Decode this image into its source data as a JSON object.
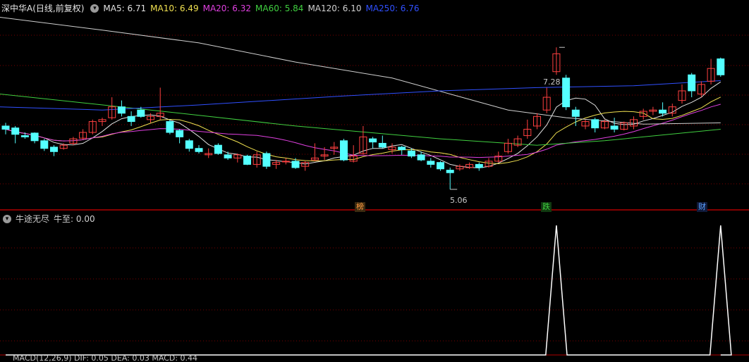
{
  "header": {
    "stock_title": "深中华A(日线,前复权)",
    "ma": [
      {
        "label": "MA5: 6.71",
        "color": "#e0e0e0"
      },
      {
        "label": "MA10: 6.49",
        "color": "#f0e050"
      },
      {
        "label": "MA20: 6.32",
        "color": "#e040e0"
      },
      {
        "label": "MA60: 5.84",
        "color": "#40d040"
      },
      {
        "label": "MA120: 6.10",
        "color": "#d0d0d0"
      },
      {
        "label": "MA250: 6.76",
        "color": "#3050ff"
      }
    ]
  },
  "indicator": {
    "name": "牛途无尽",
    "value": "牛至: 0.00"
  },
  "bottom_header": "MACD(12,26,9)  DIF: 0.05  DEA: 0.03  MACD: 0.44",
  "annotations": {
    "high": "7.28",
    "low": "5.06"
  },
  "event_tags": [
    {
      "text": "榜",
      "color": "#ff9a40"
    },
    {
      "text": "跌",
      "color": "#40d040"
    },
    {
      "text": "财",
      "color": "#5aa0ff"
    }
  ],
  "colors": {
    "up": "#ff4040",
    "down": "#54ffff",
    "grid": "#7a0000",
    "background": "#000000"
  },
  "chart_data": {
    "type": "candlestick",
    "price_range": [
      4.75,
      7.8
    ],
    "candles": [
      [
        6.05,
        6.0,
        6.1,
        5.92
      ],
      [
        6.02,
        5.92,
        6.05,
        5.78
      ],
      [
        5.9,
        5.88,
        5.95,
        5.85
      ],
      [
        5.94,
        5.82,
        5.95,
        5.78
      ],
      [
        5.82,
        5.7,
        5.85,
        5.66
      ],
      [
        5.72,
        5.65,
        5.75,
        5.58
      ],
      [
        5.7,
        5.75,
        5.78,
        5.68
      ],
      [
        5.78,
        5.85,
        5.88,
        5.75
      ],
      [
        5.86,
        5.95,
        6.0,
        5.84
      ],
      [
        5.95,
        6.12,
        6.15,
        5.92
      ],
      [
        6.12,
        6.15,
        6.18,
        6.05
      ],
      [
        6.18,
        6.35,
        6.5,
        6.15
      ],
      [
        6.35,
        6.25,
        6.45,
        6.2
      ],
      [
        6.2,
        6.12,
        6.28,
        6.05
      ],
      [
        6.3,
        6.2,
        6.35,
        6.18
      ],
      [
        6.15,
        6.2,
        6.25,
        6.1
      ],
      [
        6.2,
        6.25,
        6.65,
        6.15
      ],
      [
        6.12,
        5.95,
        6.15,
        5.92
      ],
      [
        5.98,
        5.88,
        6.0,
        5.78
      ],
      [
        5.82,
        5.7,
        5.85,
        5.65
      ],
      [
        5.7,
        5.65,
        5.75,
        5.62
      ],
      [
        5.6,
        5.62,
        5.7,
        5.55
      ],
      [
        5.75,
        5.62,
        5.78,
        5.6
      ],
      [
        5.6,
        5.55,
        5.65,
        5.52
      ],
      [
        5.55,
        5.6,
        5.62,
        5.48
      ],
      [
        5.58,
        5.45,
        5.6,
        5.44
      ],
      [
        5.45,
        5.6,
        5.65,
        5.4
      ],
      [
        5.62,
        5.42,
        5.65,
        5.38
      ],
      [
        5.45,
        5.48,
        5.52,
        5.38
      ],
      [
        5.5,
        5.5,
        5.55,
        5.45
      ],
      [
        5.5,
        5.4,
        5.55,
        5.38
      ],
      [
        5.42,
        5.48,
        5.5,
        5.35
      ],
      [
        5.52,
        5.55,
        5.78,
        5.5
      ],
      [
        5.58,
        5.6,
        5.72,
        5.52
      ],
      [
        5.7,
        5.72,
        5.8,
        5.6
      ],
      [
        5.82,
        5.52,
        5.85,
        5.5
      ],
      [
        5.5,
        5.58,
        5.75,
        5.48
      ],
      [
        5.62,
        5.88,
        6.05,
        5.6
      ],
      [
        5.85,
        5.8,
        5.88,
        5.7
      ],
      [
        5.78,
        5.72,
        5.9,
        5.7
      ],
      [
        5.68,
        5.72,
        5.78,
        5.62
      ],
      [
        5.72,
        5.68,
        5.74,
        5.6
      ],
      [
        5.66,
        5.58,
        5.7,
        5.55
      ],
      [
        5.6,
        5.52,
        5.65,
        5.5
      ],
      [
        5.5,
        5.45,
        5.55,
        5.4
      ],
      [
        5.48,
        5.38,
        5.5,
        5.35
      ],
      [
        5.36,
        5.32,
        5.4,
        5.06
      ],
      [
        5.38,
        5.42,
        5.45,
        5.35
      ],
      [
        5.4,
        5.45,
        5.48,
        5.38
      ],
      [
        5.45,
        5.4,
        5.48,
        5.35
      ],
      [
        5.42,
        5.5,
        5.55,
        5.4
      ],
      [
        5.5,
        5.58,
        5.65,
        5.48
      ],
      [
        5.65,
        5.78,
        5.85,
        5.62
      ],
      [
        5.75,
        5.85,
        5.9,
        5.72
      ],
      [
        5.9,
        6.0,
        6.15,
        5.85
      ],
      [
        6.05,
        6.2,
        6.25,
        6.0
      ],
      [
        6.3,
        6.5,
        6.65,
        6.25
      ],
      [
        6.9,
        7.18,
        7.28,
        6.85
      ],
      [
        6.8,
        6.35,
        6.85,
        6.3
      ],
      [
        6.3,
        6.2,
        6.35,
        6.05
      ],
      [
        6.05,
        6.12,
        6.15,
        6.0
      ],
      [
        6.15,
        6.02,
        6.18,
        5.95
      ],
      [
        6.02,
        6.12,
        6.15,
        6.0
      ],
      [
        6.05,
        6.0,
        6.18,
        5.95
      ],
      [
        6.0,
        6.1,
        6.12,
        5.98
      ],
      [
        6.05,
        6.15,
        6.2,
        6.0
      ],
      [
        6.2,
        6.28,
        6.32,
        6.15
      ],
      [
        6.28,
        6.3,
        6.35,
        6.22
      ],
      [
        6.3,
        6.25,
        6.42,
        6.2
      ],
      [
        6.25,
        6.35,
        6.4,
        6.2
      ],
      [
        6.45,
        6.6,
        6.7,
        6.4
      ],
      [
        6.85,
        6.6,
        6.88,
        6.5
      ],
      [
        6.55,
        6.7,
        6.75,
        6.5
      ],
      [
        6.75,
        6.95,
        7.1,
        6.7
      ],
      [
        7.1,
        6.85,
        7.12,
        6.82
      ]
    ],
    "indicator_peaks": [
      {
        "index": 57,
        "value": 1
      },
      {
        "index": 74,
        "value": 1
      }
    ]
  }
}
